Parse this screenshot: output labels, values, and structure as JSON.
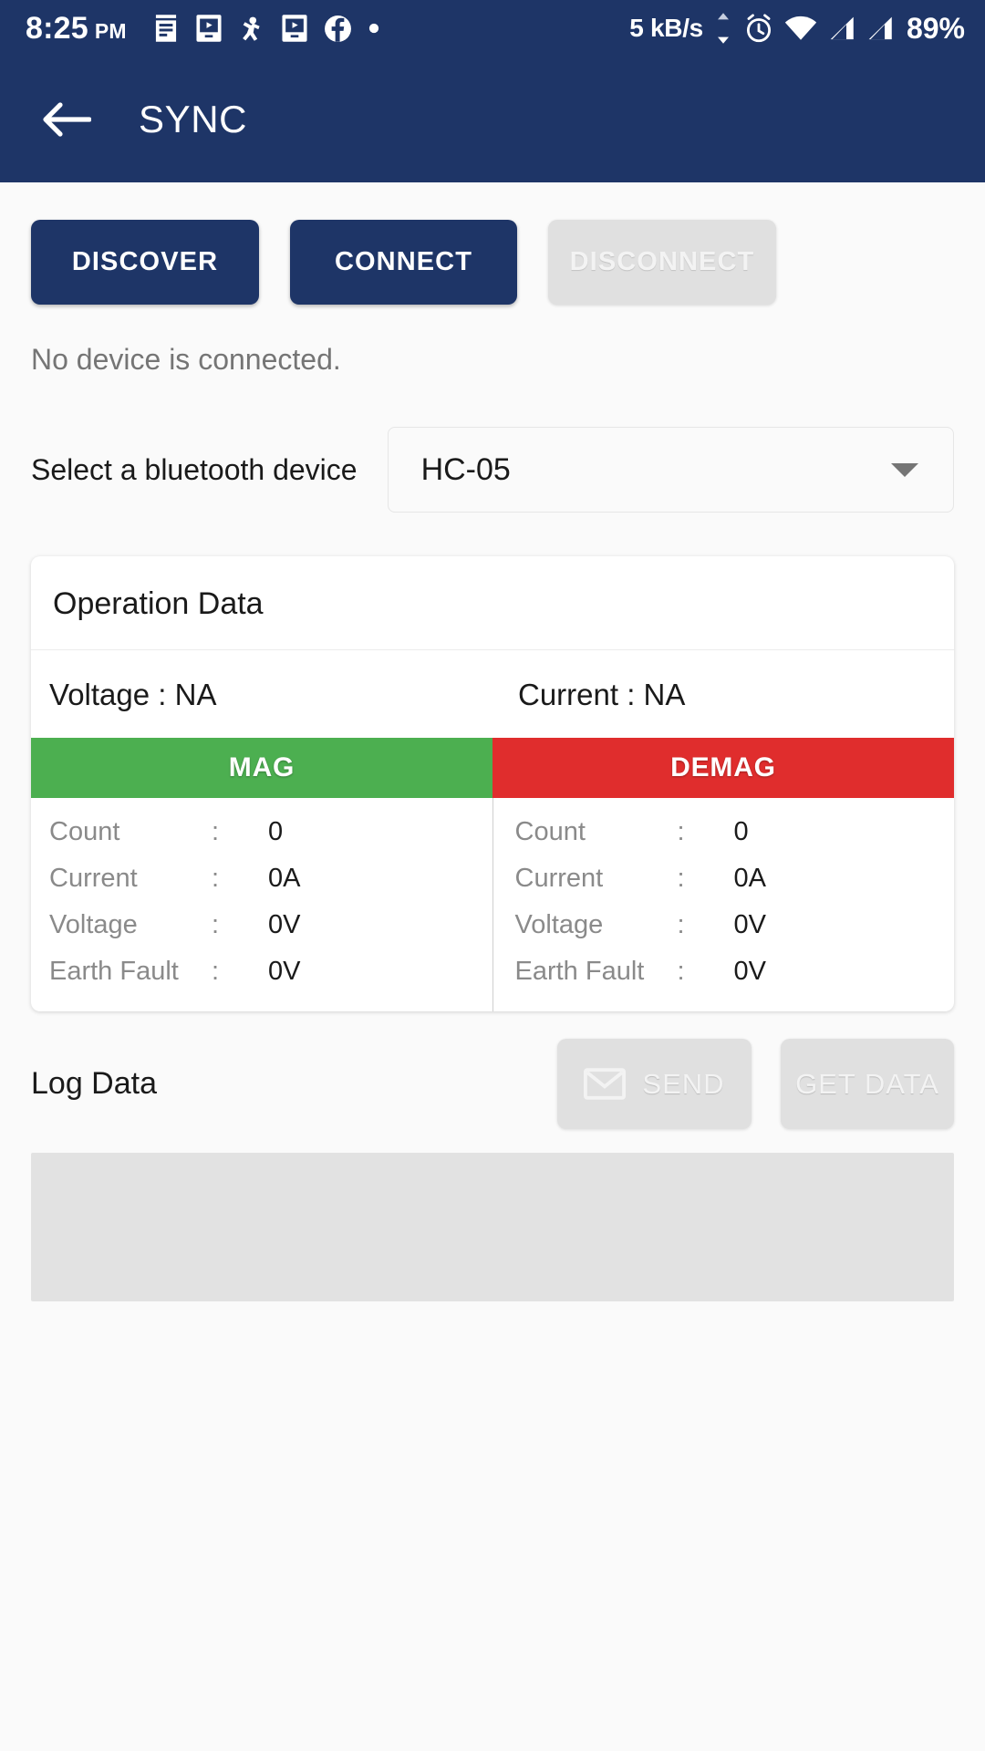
{
  "statusbar": {
    "time": "8:25",
    "ampm": "PM",
    "network_speed": "5 kB/s",
    "battery": "89%",
    "notification_icons": [
      "news-icon",
      "video-cast-icon",
      "activity-icon",
      "video-cast-icon",
      "facebook-icon",
      "dot-icon"
    ],
    "system_icons": [
      "data-transfer-icon",
      "alarm-icon",
      "wifi-icon",
      "signal-sim1-icon",
      "signal-sim2-icon"
    ]
  },
  "appbar": {
    "back_label": "back-arrow",
    "title": "SYNC",
    "background_color": "#1e3567"
  },
  "actions": {
    "discover": "DISCOVER",
    "connect": "CONNECT",
    "disconnect": "DISCONNECT"
  },
  "status_text": "No device is connected.",
  "device_select": {
    "label": "Select a bluetooth device",
    "value": "HC-05"
  },
  "operation_card": {
    "title": "Operation Data",
    "summary": {
      "voltage": "Voltage : NA",
      "current": "Current : NA"
    },
    "columns": [
      {
        "header": "MAG",
        "color": "#4caf50",
        "rows": [
          {
            "label": "Count",
            "colon": ":",
            "value": "0"
          },
          {
            "label": "Current",
            "colon": ":",
            "value": "0A"
          },
          {
            "label": "Voltage",
            "colon": ":",
            "value": "0V"
          },
          {
            "label": "Earth Fault",
            "colon": ":",
            "value": "0V"
          }
        ]
      },
      {
        "header": "DEMAG",
        "color": "#e02d2d",
        "rows": [
          {
            "label": "Count",
            "colon": ":",
            "value": "0"
          },
          {
            "label": "Current",
            "colon": ":",
            "value": "0A"
          },
          {
            "label": "Voltage",
            "colon": ":",
            "value": "0V"
          },
          {
            "label": "Earth Fault",
            "colon": ":",
            "value": "0V"
          }
        ]
      }
    ]
  },
  "log": {
    "title": "Log Data",
    "send_label": "SEND",
    "get_data_label": "GET DATA",
    "output": ""
  }
}
